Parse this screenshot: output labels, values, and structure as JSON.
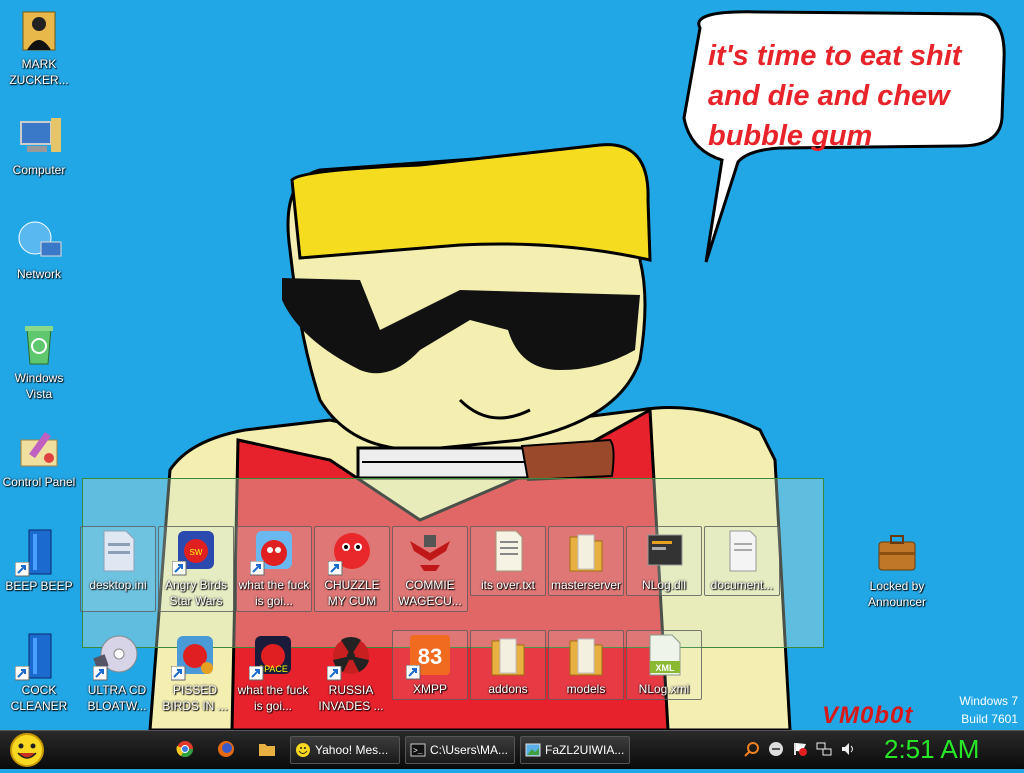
{
  "wallpaper": {
    "speech": [
      "it's time to eat shit",
      "and die and chew",
      "bubble gum"
    ],
    "signature": "VM0b0t"
  },
  "watermark": {
    "os": "Windows 7",
    "build": "Build 7601"
  },
  "desktop_icons": [
    {
      "label": "MARK ZUCKER...",
      "icon": "folder-person-icon"
    },
    {
      "label": "Computer",
      "icon": "computer-icon"
    },
    {
      "label": "Network",
      "icon": "network-icon"
    },
    {
      "label": "Windows Vista",
      "icon": "recycle-bin-icon"
    },
    {
      "label": "Control Panel",
      "icon": "control-panel-icon"
    },
    {
      "label": "BEEP BEEP",
      "icon": "blue-book-icon"
    },
    {
      "label": "COCK CLEANER",
      "icon": "blue-book-icon"
    },
    {
      "label": "desktop.ini",
      "icon": "settings-file-icon"
    },
    {
      "label": "Angry Birds Star Wars",
      "icon": "angry-birds-starwars-icon"
    },
    {
      "label": "what the fuck is goi...",
      "icon": "angry-birds-icon"
    },
    {
      "label": "CHUZZLE MY CUM",
      "icon": "chuzzle-icon"
    },
    {
      "label": "COMMIE WAGECU...",
      "icon": "eagle-emblem-icon"
    },
    {
      "label": "its over.txt",
      "icon": "text-file-icon"
    },
    {
      "label": "masterserver",
      "icon": "folder-icon"
    },
    {
      "label": "NLog.dll",
      "icon": "dll-file-icon"
    },
    {
      "label": "document...",
      "icon": "document-file-icon"
    },
    {
      "label": "ULTRA CD BLOATW...",
      "icon": "cd-icon"
    },
    {
      "label": "PISSED BIRDS IN ...",
      "icon": "angry-birds-space-icon"
    },
    {
      "label": "what the fuck is goi...",
      "icon": "angry-birds-space-icon"
    },
    {
      "label": "RUSSIA INVADES ...",
      "icon": "radiation-icon"
    },
    {
      "label": "XMPP",
      "icon": "xampp-icon"
    },
    {
      "label": "addons",
      "icon": "folder-icon"
    },
    {
      "label": "models",
      "icon": "folder-icon"
    },
    {
      "label": "NLog.xml",
      "icon": "xml-file-icon"
    },
    {
      "label": "Locked by Announcer",
      "icon": "briefcase-icon"
    }
  ],
  "taskbar": {
    "start": {
      "icon": "yahoo-smiley-icon"
    },
    "quick_launch": [
      {
        "icon": "chrome-icon"
      },
      {
        "icon": "firefox-icon"
      },
      {
        "icon": "folder-icon"
      }
    ],
    "tasks": [
      {
        "label": "Yahoo! Mes...",
        "icon": "yahoo-smiley-icon"
      },
      {
        "label": "C:\\Users\\MA...",
        "icon": "console-icon"
      },
      {
        "label": "FaZL2UIWIA...",
        "icon": "image-file-icon"
      }
    ],
    "tray": [
      {
        "icon": "search-icon"
      },
      {
        "icon": "minus-circle-icon"
      },
      {
        "icon": "action-center-flag-icon"
      },
      {
        "icon": "network-tray-icon"
      },
      {
        "icon": "volume-icon"
      }
    ],
    "clock": "2:51 AM"
  },
  "colors": {
    "sky": "#22a7e6",
    "speech_text": "#e8232a",
    "clock": "#27e827",
    "hat": "#f5dc1e",
    "skin": "#f4eeb0",
    "shirt": "#e8222c"
  }
}
